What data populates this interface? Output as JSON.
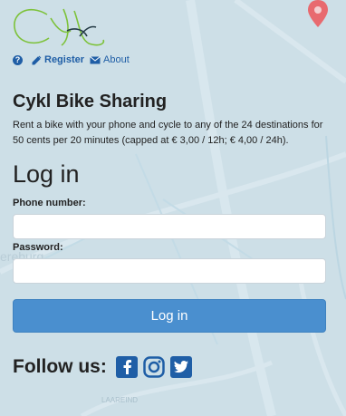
{
  "links": {
    "register": "Register",
    "about": "About"
  },
  "heading": {
    "title": "Cykl Bike Sharing",
    "description": "Rent a bike with your phone and cycle to any of the 24 destinations for 50 cents per 20 minutes (capped at € 3,00 / 12h; € 4,00 / 24h)."
  },
  "login": {
    "title": "Log in",
    "phone_label": "Phone number:",
    "password_label": "Password:",
    "phone_value": "",
    "password_value": "",
    "submit_label": "Log in"
  },
  "follow": {
    "label": "Follow us:",
    "icons": [
      "facebook-icon",
      "instagram-icon",
      "twitter-icon"
    ]
  },
  "map_labels": {
    "left_label": "ereburg",
    "bottom_label": "LAAREIND"
  },
  "colors": {
    "link": "#1f5ea6",
    "button": "#4a8fcf",
    "pin": "#e86a6f",
    "logo_green": "#7dc23a"
  }
}
